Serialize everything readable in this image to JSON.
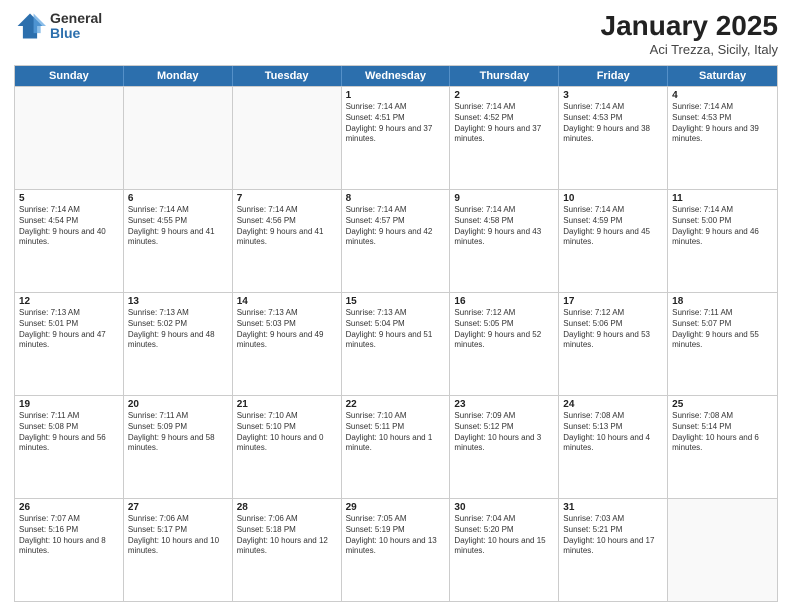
{
  "logo": {
    "general": "General",
    "blue": "Blue"
  },
  "header": {
    "month": "January 2025",
    "location": "Aci Trezza, Sicily, Italy"
  },
  "weekdays": [
    "Sunday",
    "Monday",
    "Tuesday",
    "Wednesday",
    "Thursday",
    "Friday",
    "Saturday"
  ],
  "weeks": [
    [
      {
        "day": "",
        "empty": true
      },
      {
        "day": "",
        "empty": true
      },
      {
        "day": "",
        "empty": true
      },
      {
        "day": "1",
        "sunrise": "Sunrise: 7:14 AM",
        "sunset": "Sunset: 4:51 PM",
        "daylight": "Daylight: 9 hours and 37 minutes."
      },
      {
        "day": "2",
        "sunrise": "Sunrise: 7:14 AM",
        "sunset": "Sunset: 4:52 PM",
        "daylight": "Daylight: 9 hours and 37 minutes."
      },
      {
        "day": "3",
        "sunrise": "Sunrise: 7:14 AM",
        "sunset": "Sunset: 4:53 PM",
        "daylight": "Daylight: 9 hours and 38 minutes."
      },
      {
        "day": "4",
        "sunrise": "Sunrise: 7:14 AM",
        "sunset": "Sunset: 4:53 PM",
        "daylight": "Daylight: 9 hours and 39 minutes."
      }
    ],
    [
      {
        "day": "5",
        "sunrise": "Sunrise: 7:14 AM",
        "sunset": "Sunset: 4:54 PM",
        "daylight": "Daylight: 9 hours and 40 minutes."
      },
      {
        "day": "6",
        "sunrise": "Sunrise: 7:14 AM",
        "sunset": "Sunset: 4:55 PM",
        "daylight": "Daylight: 9 hours and 41 minutes."
      },
      {
        "day": "7",
        "sunrise": "Sunrise: 7:14 AM",
        "sunset": "Sunset: 4:56 PM",
        "daylight": "Daylight: 9 hours and 41 minutes."
      },
      {
        "day": "8",
        "sunrise": "Sunrise: 7:14 AM",
        "sunset": "Sunset: 4:57 PM",
        "daylight": "Daylight: 9 hours and 42 minutes."
      },
      {
        "day": "9",
        "sunrise": "Sunrise: 7:14 AM",
        "sunset": "Sunset: 4:58 PM",
        "daylight": "Daylight: 9 hours and 43 minutes."
      },
      {
        "day": "10",
        "sunrise": "Sunrise: 7:14 AM",
        "sunset": "Sunset: 4:59 PM",
        "daylight": "Daylight: 9 hours and 45 minutes."
      },
      {
        "day": "11",
        "sunrise": "Sunrise: 7:14 AM",
        "sunset": "Sunset: 5:00 PM",
        "daylight": "Daylight: 9 hours and 46 minutes."
      }
    ],
    [
      {
        "day": "12",
        "sunrise": "Sunrise: 7:13 AM",
        "sunset": "Sunset: 5:01 PM",
        "daylight": "Daylight: 9 hours and 47 minutes."
      },
      {
        "day": "13",
        "sunrise": "Sunrise: 7:13 AM",
        "sunset": "Sunset: 5:02 PM",
        "daylight": "Daylight: 9 hours and 48 minutes."
      },
      {
        "day": "14",
        "sunrise": "Sunrise: 7:13 AM",
        "sunset": "Sunset: 5:03 PM",
        "daylight": "Daylight: 9 hours and 49 minutes."
      },
      {
        "day": "15",
        "sunrise": "Sunrise: 7:13 AM",
        "sunset": "Sunset: 5:04 PM",
        "daylight": "Daylight: 9 hours and 51 minutes."
      },
      {
        "day": "16",
        "sunrise": "Sunrise: 7:12 AM",
        "sunset": "Sunset: 5:05 PM",
        "daylight": "Daylight: 9 hours and 52 minutes."
      },
      {
        "day": "17",
        "sunrise": "Sunrise: 7:12 AM",
        "sunset": "Sunset: 5:06 PM",
        "daylight": "Daylight: 9 hours and 53 minutes."
      },
      {
        "day": "18",
        "sunrise": "Sunrise: 7:11 AM",
        "sunset": "Sunset: 5:07 PM",
        "daylight": "Daylight: 9 hours and 55 minutes."
      }
    ],
    [
      {
        "day": "19",
        "sunrise": "Sunrise: 7:11 AM",
        "sunset": "Sunset: 5:08 PM",
        "daylight": "Daylight: 9 hours and 56 minutes."
      },
      {
        "day": "20",
        "sunrise": "Sunrise: 7:11 AM",
        "sunset": "Sunset: 5:09 PM",
        "daylight": "Daylight: 9 hours and 58 minutes."
      },
      {
        "day": "21",
        "sunrise": "Sunrise: 7:10 AM",
        "sunset": "Sunset: 5:10 PM",
        "daylight": "Daylight: 10 hours and 0 minutes."
      },
      {
        "day": "22",
        "sunrise": "Sunrise: 7:10 AM",
        "sunset": "Sunset: 5:11 PM",
        "daylight": "Daylight: 10 hours and 1 minute."
      },
      {
        "day": "23",
        "sunrise": "Sunrise: 7:09 AM",
        "sunset": "Sunset: 5:12 PM",
        "daylight": "Daylight: 10 hours and 3 minutes."
      },
      {
        "day": "24",
        "sunrise": "Sunrise: 7:08 AM",
        "sunset": "Sunset: 5:13 PM",
        "daylight": "Daylight: 10 hours and 4 minutes."
      },
      {
        "day": "25",
        "sunrise": "Sunrise: 7:08 AM",
        "sunset": "Sunset: 5:14 PM",
        "daylight": "Daylight: 10 hours and 6 minutes."
      }
    ],
    [
      {
        "day": "26",
        "sunrise": "Sunrise: 7:07 AM",
        "sunset": "Sunset: 5:16 PM",
        "daylight": "Daylight: 10 hours and 8 minutes."
      },
      {
        "day": "27",
        "sunrise": "Sunrise: 7:06 AM",
        "sunset": "Sunset: 5:17 PM",
        "daylight": "Daylight: 10 hours and 10 minutes."
      },
      {
        "day": "28",
        "sunrise": "Sunrise: 7:06 AM",
        "sunset": "Sunset: 5:18 PM",
        "daylight": "Daylight: 10 hours and 12 minutes."
      },
      {
        "day": "29",
        "sunrise": "Sunrise: 7:05 AM",
        "sunset": "Sunset: 5:19 PM",
        "daylight": "Daylight: 10 hours and 13 minutes."
      },
      {
        "day": "30",
        "sunrise": "Sunrise: 7:04 AM",
        "sunset": "Sunset: 5:20 PM",
        "daylight": "Daylight: 10 hours and 15 minutes."
      },
      {
        "day": "31",
        "sunrise": "Sunrise: 7:03 AM",
        "sunset": "Sunset: 5:21 PM",
        "daylight": "Daylight: 10 hours and 17 minutes."
      },
      {
        "day": "",
        "empty": true
      }
    ]
  ]
}
